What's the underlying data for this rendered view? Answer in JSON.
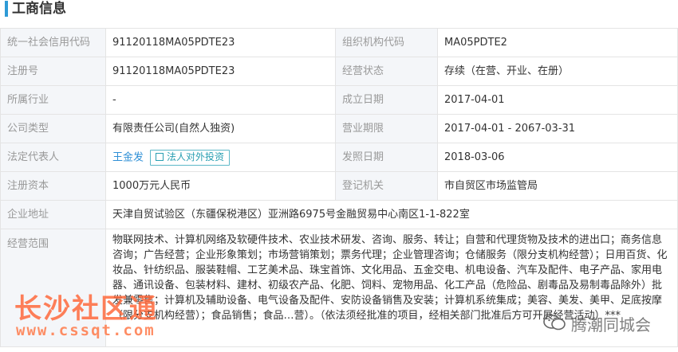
{
  "section": {
    "title": "工商信息"
  },
  "fields": {
    "credit_code_label": "统一社会信用代码",
    "credit_code_value": "91120118MA05PDTE23",
    "org_code_label": "组织机构代码",
    "org_code_value": "MA05PDTE2",
    "reg_no_label": "注册号",
    "reg_no_value": "91120118MA05PDTE23",
    "status_label": "经营状态",
    "status_value": "存续（在营、开业、在册）",
    "industry_label": "所属行业",
    "industry_value": "-",
    "established_label": "成立日期",
    "established_value": "2017-04-01",
    "company_type_label": "公司类型",
    "company_type_value": "有限责任公司(自然人独资)",
    "term_label": "营业期限",
    "term_value": "2017-04-01 - 2067-03-31",
    "legal_rep_label": "法定代表人",
    "legal_rep_value": "王金发",
    "legal_rep_button": "法人对外投资",
    "issue_date_label": "发照日期",
    "issue_date_value": "2018-03-06",
    "capital_label": "注册资本",
    "capital_value": "1000万元人民币",
    "authority_label": "登记机关",
    "authority_value": "市自贸区市场监管局",
    "address_label": "企业地址",
    "address_value": "天津自贸试验区（东疆保税港区）亚洲路6975号金融贸易中心南区1-1-822室",
    "scope_label": "经营范围",
    "scope_value": "物联网技术、计算机网络及软硬件技术、农业技术研发、咨询、服务、转让；自营和代理货物及技术的进出口；商务信息咨询；广告经营；企业形象策划；市场营销策划；票务代理；企业管理咨询；仓储服务（限分支机构经营）；日用百货、化妆品、针纺织品、服装鞋帽、工艺美术品、珠宝首饰、文化用品、五金交电、机电设备、汽车及配件、电子产品、家用电器、通讯设备、包装材料、建材、初级农产品、化肥、饲料、宠物用品、化工产品（危险品、剧毒品及易制毒品除外）批发兼零售；计算机及辅助设备、电气设备及配件、安防设备销售及安装；计算机系统集成；美容、美发、美甲、足底按摩（限分支机构经营）；食品销售；食品…营）。（依法须经批准的项目，经相关部门批准后方可开展经营活动）***"
  },
  "watermarks": {
    "left_title": "长沙社区通",
    "left_url": "www.cssqt.com",
    "right_text": "腾潮同城会"
  },
  "colors": {
    "accent": "#2e9bd6",
    "label_bg": "#f4f6f9",
    "link": "#2e8fd6",
    "watermark": "#ff6a3d"
  }
}
